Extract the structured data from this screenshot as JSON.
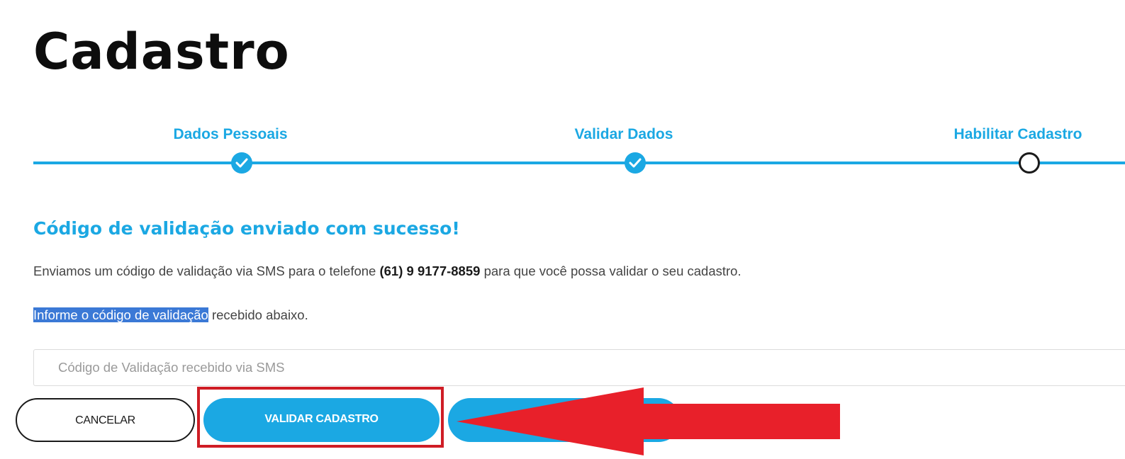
{
  "header": {
    "title": "Cadastro"
  },
  "stepper": {
    "steps": [
      {
        "label": "Dados Pessoais",
        "status": "done"
      },
      {
        "label": "Validar Dados",
        "status": "done"
      },
      {
        "label": "Habilitar Cadastro",
        "status": "pending"
      }
    ],
    "accent_color": "#1ba8e3"
  },
  "main": {
    "heading": "Código de validação enviado com sucesso!",
    "sms_message": {
      "before": "Enviamos um código de validação via SMS para o telefone ",
      "phone": "(61) 9 9177-8859",
      "after": " para que você possa validar o seu cadastro."
    },
    "instruction": {
      "highlighted": "Informe o código de validação",
      "rest": " recebido abaixo."
    },
    "code_input": {
      "placeholder": "Código de Validação recebido via SMS",
      "value": ""
    }
  },
  "actions": {
    "cancel_label": "CANCELAR",
    "validate_label": "VALIDAR CADASTRO"
  },
  "annotation": {
    "box_color": "#cf1d25",
    "arrow_color": "#e8202a",
    "arrow_icon": "left-arrow-icon"
  }
}
